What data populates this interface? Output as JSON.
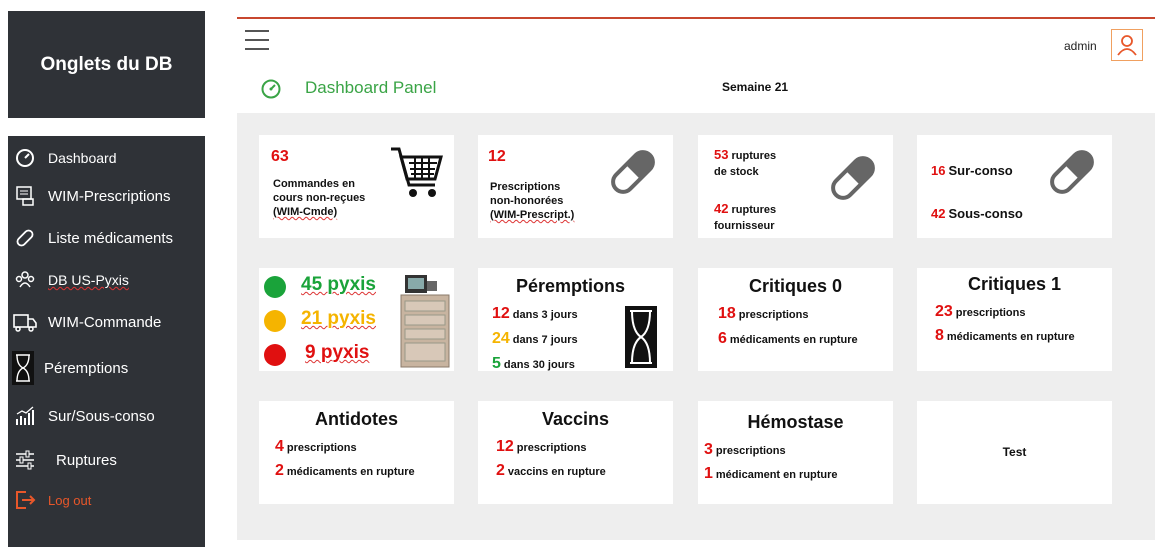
{
  "db_title": "Onglets du DB",
  "sidebar": {
    "items": [
      {
        "label": "Dashboard",
        "icon": "dashboard-icon"
      },
      {
        "label": "WIM-Prescriptions",
        "icon": "prescription-icon"
      },
      {
        "label": "Liste médicaments",
        "icon": "pill-icon"
      },
      {
        "label": "DB US-Pyxis",
        "icon": "group-icon"
      },
      {
        "label": "WIM-Commande",
        "icon": "truck-icon"
      },
      {
        "label": "Péremptions",
        "icon": "hourglass-icon"
      },
      {
        "label": "Sur/Sous-conso",
        "icon": "bar-chart-icon"
      },
      {
        "label": "Ruptures",
        "icon": "sliders-icon"
      },
      {
        "label": "Log out",
        "icon": "logout-icon"
      }
    ]
  },
  "header": {
    "user": "admin",
    "title": "Dashboard Panel",
    "week": "Semaine 21"
  },
  "cards": {
    "commandes": {
      "count": "63",
      "text1": "Commandes en",
      "text2": "cours non-reçues",
      "text3": "(WIM-Cmde)"
    },
    "prescriptions": {
      "count": "12",
      "text1": "Prescriptions",
      "text2": "non-honorées",
      "text3": "(WIM-Prescript.)"
    },
    "ruptures": {
      "n1": "53",
      "t1a": "ruptures",
      "t1b": "de stock",
      "n2": "42",
      "t2a": "ruptures",
      "t2b": "fournisseur"
    },
    "conso": {
      "n1": "16",
      "t1": "Sur-conso",
      "n2": "42",
      "t2": "Sous-conso"
    },
    "pyxis": {
      "green": "45 pyxis",
      "yellow": "21 pyxis",
      "red": "9 pyxis",
      "colors": {
        "green": "#1aa33a",
        "yellow": "#f5b400",
        "red": "#e01010"
      }
    },
    "peremptions": {
      "title": "Péremptions",
      "r1n": "12",
      "r1t": "dans 3 jours",
      "r2n": "24",
      "r2t": "dans 7 jours",
      "r3n": "5",
      "r3t": "dans 30 jours"
    },
    "critiques0": {
      "title": "Critiques 0",
      "n1": "18",
      "t1": "prescriptions",
      "n2": "6",
      "t2": "médicaments en rupture"
    },
    "critiques1": {
      "title": "Critiques 1",
      "n1": "23",
      "t1": "prescriptions",
      "n2": "8",
      "t2": "médicaments en rupture"
    },
    "antidotes": {
      "title": "Antidotes",
      "n1": "4",
      "t1": "prescriptions",
      "n2": "2",
      "t2": "médicaments en rupture"
    },
    "vaccins": {
      "title": "Vaccins",
      "n1": "12",
      "t1": "prescriptions",
      "n2": "2",
      "t2": "vaccins en rupture"
    },
    "hemostase": {
      "title": "Hémostase",
      "n1": "3",
      "t1": "prescriptions",
      "n2": "1",
      "t2": "médicament en rupture"
    },
    "test": {
      "title": "Test"
    }
  }
}
